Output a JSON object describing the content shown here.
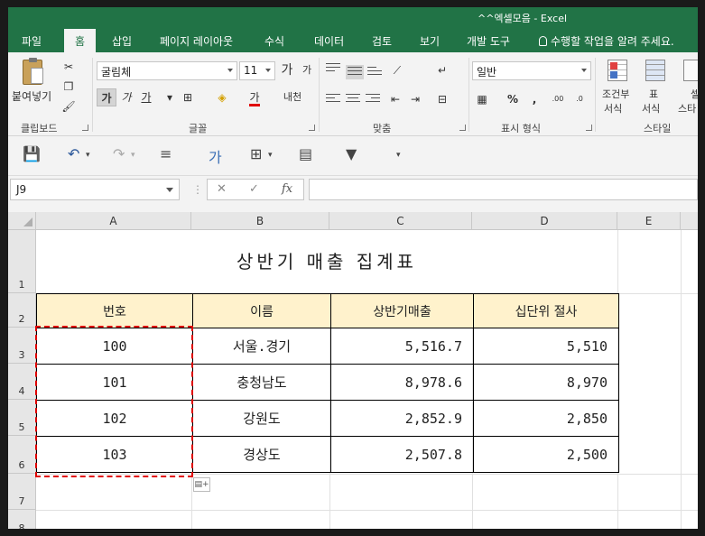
{
  "window": {
    "title": "^^엑셀모음 - Excel"
  },
  "tabs": [
    "파일",
    "홈",
    "삽입",
    "페이지 레이아웃",
    "수식",
    "데이터",
    "검토",
    "보기",
    "개발 도구"
  ],
  "tell_me": "수행할 작업을 알려 주세요.",
  "ribbon": {
    "clipboard": {
      "paste_label": "붙여넣기",
      "group_label": "클립보드"
    },
    "font": {
      "name": "굴림체",
      "size": "11",
      "group_label": "글꼴",
      "bold": "가",
      "italic": "가",
      "underline": "가",
      "font_color_glyph": "가",
      "phonetic": "내천"
    },
    "alignment": {
      "group_label": "맞춤"
    },
    "number": {
      "format": "일반",
      "group_label": "표시 형식",
      "percent": "%",
      "comma": ","
    },
    "styles": {
      "conditional_label_1": "조건부",
      "conditional_label_2": "서식",
      "table_label_1": "표",
      "table_label_2": "서식",
      "cell_label_1": "셀",
      "cell_label_2": "스타",
      "group_label": "스타일"
    }
  },
  "formula_bar": {
    "name_box": "J9",
    "fx": "fx",
    "formula": ""
  },
  "columns": [
    "A",
    "B",
    "C",
    "D",
    "E"
  ],
  "rows": [
    "1",
    "2",
    "3",
    "4",
    "5",
    "6",
    "7",
    "8"
  ],
  "sheet": {
    "title": "상반기 매출 집계표",
    "headers": [
      "번호",
      "이름",
      "상반기매출",
      "십단위 절사"
    ],
    "data": [
      [
        "100",
        "서울.경기",
        "5,516.7",
        "5,510"
      ],
      [
        "101",
        "충청남도",
        "8,978.6",
        "8,970"
      ],
      [
        "102",
        "강원도",
        "2,852.9",
        "2,850"
      ],
      [
        "103",
        "경상도",
        "2,507.8",
        "2,500"
      ]
    ]
  },
  "colors": {
    "excel_green": "#217346",
    "header_fill": "#fff2cc",
    "marquee": "#e00000"
  }
}
